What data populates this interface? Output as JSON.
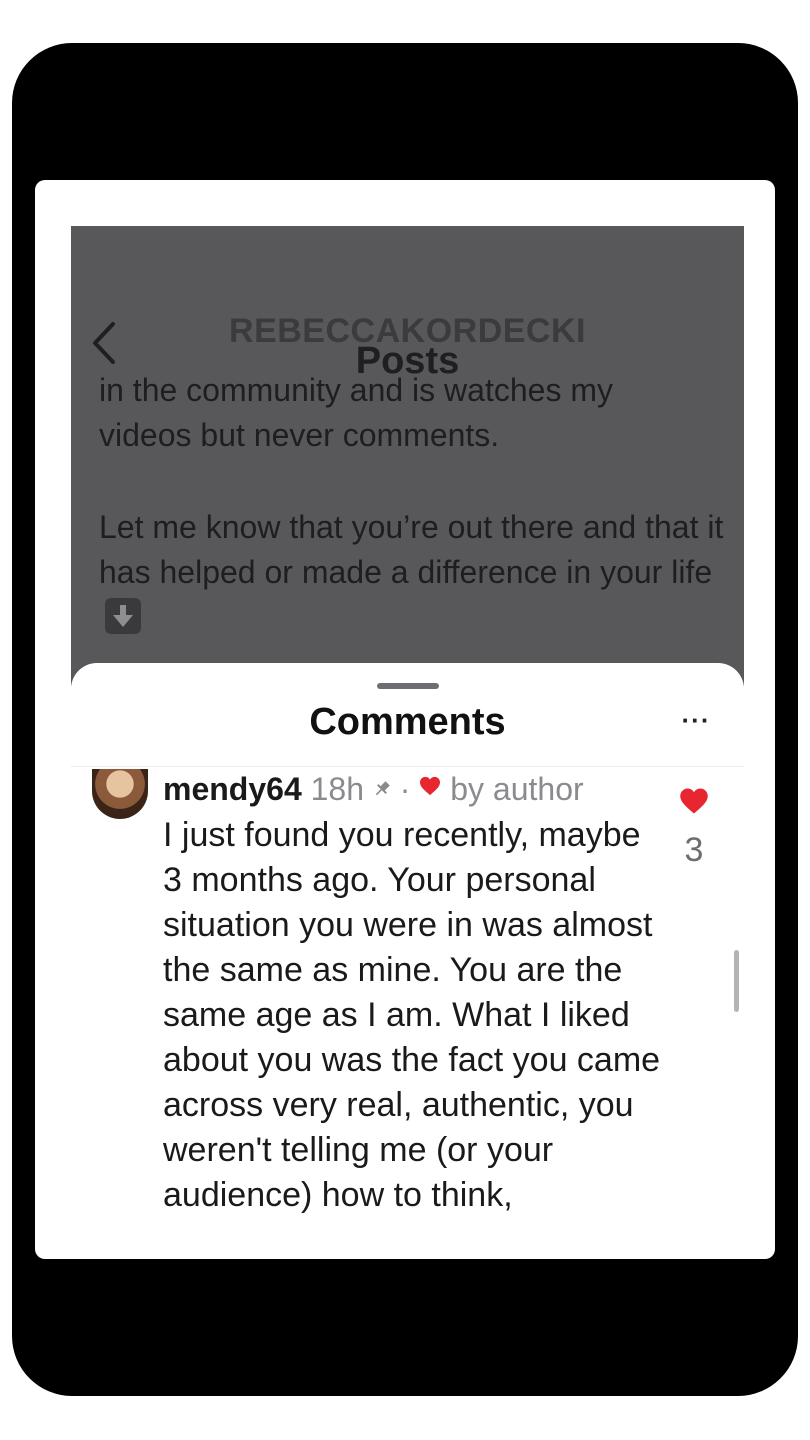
{
  "header": {
    "username": "REBECCAKORDECKI",
    "title": "Posts",
    "back_icon": "chevron-left-icon"
  },
  "post": {
    "line1": "in the community and is watches my",
    "line2": "videos but never comments.",
    "paragraph2": "Let me know that you’re out there and that it has helped or made a difference in your life",
    "emoji_icon": "down-arrow-icon"
  },
  "comments_sheet": {
    "title": "Comments",
    "more_label": "···",
    "comment": {
      "username": "mendy64",
      "time": "18h",
      "pin_icon": "pin-icon",
      "separator": "·",
      "badge": "by author",
      "body": "I just found you recently, maybe 3 months ago. Your personal situation you were in was almost the same as mine. You are the same age as I am. What I liked about you was the fact you came across very real, authentic, you weren't telling me (or your audience) how to think,",
      "like_count": "3"
    }
  },
  "colors": {
    "frame": "#000000",
    "dim_overlay": "#58585b",
    "heart": "#e8262f",
    "muted_text": "#8b8b8f"
  }
}
